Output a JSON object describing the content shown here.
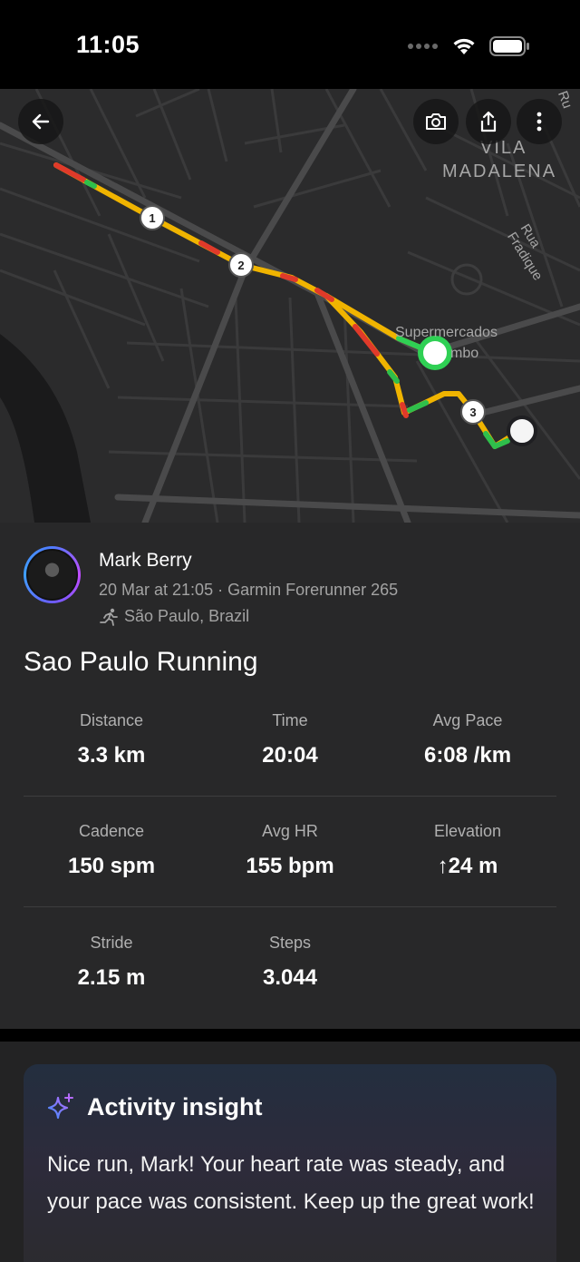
{
  "status_bar": {
    "time": "11:05"
  },
  "map": {
    "district_line1": "VILA",
    "district_line2": "MADALENA",
    "street": "Rua Fradique",
    "street_edge": "Ru",
    "poi_line1": "Supermercados",
    "poi_line2": "mbo",
    "markers": [
      "1",
      "2",
      "3"
    ],
    "route_colors": {
      "main": "#f0b400",
      "slow": "#e03a2a",
      "fast": "#2fbf4b",
      "start": "#2fd054"
    }
  },
  "activity": {
    "user_name": "Mark Berry",
    "meta": "20 Mar at 21:05 · Garmin Forerunner 265",
    "location": "São Paulo, Brazil",
    "title": "Sao Paulo Running",
    "stats": [
      {
        "label": "Distance",
        "value": "3.3 km"
      },
      {
        "label": "Time",
        "value": "20:04"
      },
      {
        "label": "Avg Pace",
        "value": "6:08 /km"
      },
      {
        "label": "Cadence",
        "value": "150 spm"
      },
      {
        "label": "Avg HR",
        "value": "155 bpm"
      },
      {
        "label": "Elevation",
        "value": "↑24 m"
      },
      {
        "label": "Stride",
        "value": "2.15 m"
      },
      {
        "label": "Steps",
        "value": "3.044"
      }
    ]
  },
  "insight": {
    "title": "Activity insight",
    "text": "Nice run, Mark! Your heart rate was steady, and your pace was consistent. Keep up the great work!"
  },
  "icons": {
    "back": "arrow-left-icon",
    "camera": "camera-icon",
    "share": "share-icon",
    "more": "more-vertical-icon",
    "sparkle": "sparkle-icon",
    "runner": "runner-icon"
  }
}
